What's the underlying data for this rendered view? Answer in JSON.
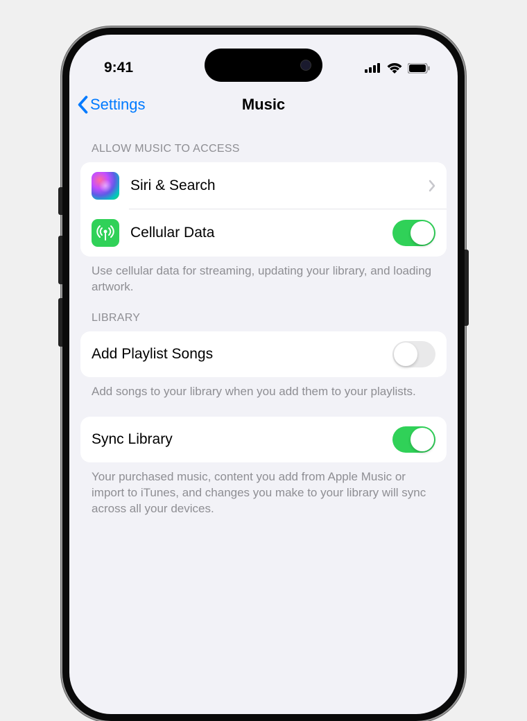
{
  "status_bar": {
    "time": "9:41"
  },
  "nav": {
    "back_label": "Settings",
    "title": "Music"
  },
  "sections": {
    "access": {
      "header": "Allow Music to Access",
      "siri_label": "Siri & Search",
      "cellular_label": "Cellular Data",
      "cellular_on": true,
      "footer": "Use cellular data for streaming, updating your library, and loading artwork."
    },
    "library": {
      "header": "Library",
      "add_playlist_label": "Add Playlist Songs",
      "add_playlist_on": false,
      "add_playlist_footer": "Add songs to your library when you add them to your playlists.",
      "sync_label": "Sync Library",
      "sync_on": true,
      "sync_footer": "Your purchased music, content you add from Apple Music or import to iTunes, and changes you make to your library will sync across all your devices."
    }
  },
  "colors": {
    "accent": "#007aff",
    "toggle_on": "#30d158",
    "toggle_off": "#e9e9ea",
    "bg": "#f2f2f7"
  }
}
